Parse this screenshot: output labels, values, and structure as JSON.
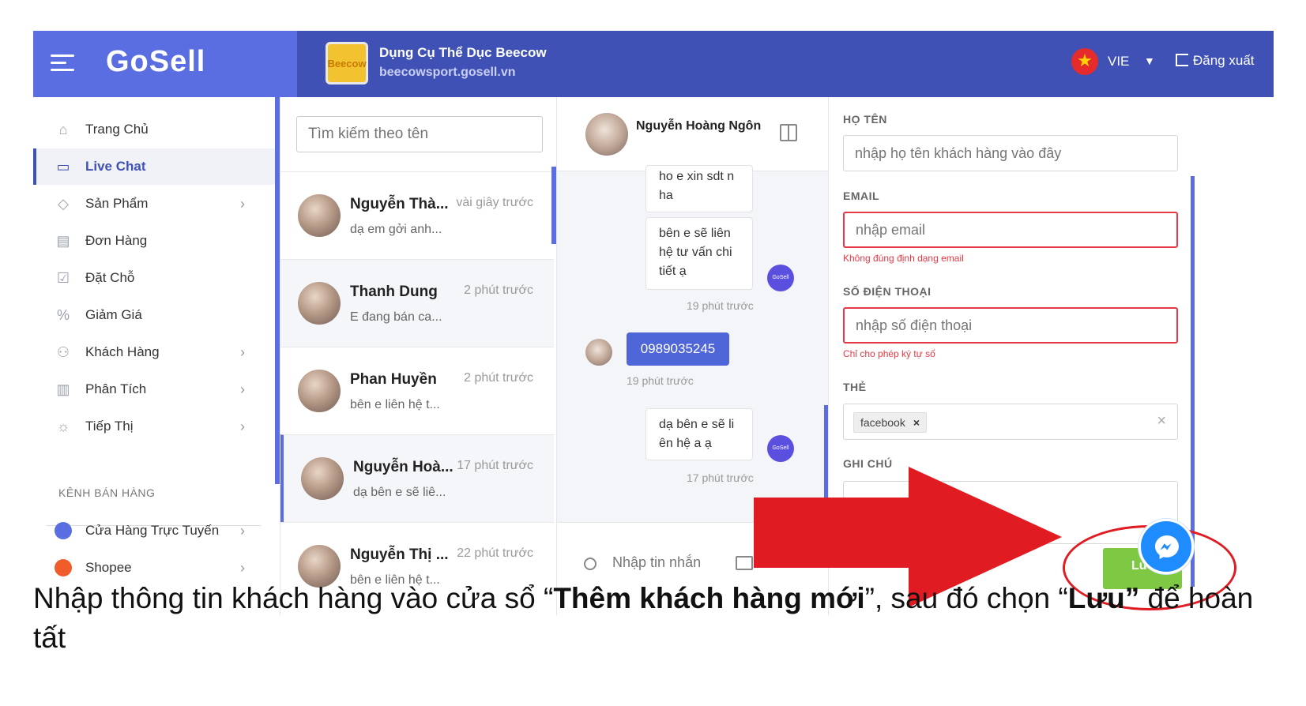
{
  "header": {
    "logo_text": "GoSell",
    "shop_logo_text": "Beecow",
    "shop_name": "Dụng Cụ Thể Dục Beecow",
    "shop_url": "beecowsport.gosell.vn",
    "language": "VIE",
    "logout_label": "Đăng xuất"
  },
  "sidebar": {
    "items": [
      {
        "label": "Trang Chủ",
        "icon": "home-icon"
      },
      {
        "label": "Live Chat",
        "icon": "chat-icon"
      },
      {
        "label": "Sản Phẩm",
        "icon": "tag-icon"
      },
      {
        "label": "Đơn Hàng",
        "icon": "document-icon"
      },
      {
        "label": "Đặt Chỗ",
        "icon": "calendar-check-icon"
      },
      {
        "label": "Giảm Giá",
        "icon": "discount-icon"
      },
      {
        "label": "Khách Hàng",
        "icon": "users-icon"
      },
      {
        "label": "Phân Tích",
        "icon": "bar-chart-icon"
      },
      {
        "label": "Tiếp Thị",
        "icon": "lightbulb-icon"
      }
    ],
    "section_title": "KÊNH BÁN HÀNG",
    "channels": [
      {
        "label": "Cửa Hàng Trực Tuyến",
        "icon": "store-icon"
      },
      {
        "label": "Shopee",
        "icon": "shopee-icon"
      }
    ]
  },
  "conversations": {
    "search_placeholder": "Tìm kiếm theo tên",
    "items": [
      {
        "name": "Nguyễn Thà...",
        "time": "vài giây trước",
        "preview": "dạ em gởi anh..."
      },
      {
        "name": "Thanh Dung",
        "time": "2 phút trước",
        "preview": "E đang bán ca..."
      },
      {
        "name": "Phan Huyền",
        "time": "2 phút trước",
        "preview": "bên e liên hệ t..."
      },
      {
        "name": "Nguyễn Hoà...",
        "time": "17 phút trước",
        "preview": "dạ bên e sẽ liê..."
      },
      {
        "name": "Nguyễn Thị ...",
        "time": "22 phút trước",
        "preview": "bên e liên hệ t..."
      }
    ]
  },
  "chat": {
    "contact_name": "Nguyễn Hoàng Ngôn",
    "messages": {
      "m1": "ho e xin sdt n ha",
      "m2": "bên e sẽ liên hệ tư vấn chi tiết ạ",
      "m2_time": "19 phút trước",
      "m3": "0989035245",
      "m3_time": "19 phút trước",
      "m4": "dạ bên e sẽ li ên hệ a ạ",
      "m4_time": "17 phút trước"
    },
    "input_placeholder": "Nhập tin nhắn",
    "mini_logo": "GoSell"
  },
  "form": {
    "name_label": "HỌ TÊN",
    "name_placeholder": "nhập họ tên khách hàng vào đây",
    "email_label": "EMAIL",
    "email_placeholder": "nhập email",
    "email_error": "Không đúng định dạng email",
    "phone_label": "SỐ ĐIỆN THOẠI",
    "phone_placeholder": "nhập số điện thoại",
    "phone_error": "Chỉ cho phép ký tự số",
    "tag_label": "THẺ",
    "tag_value": "facebook",
    "note_label": "GHI CHÚ",
    "save_label": "Lư"
  },
  "caption": {
    "part1": "Nhập thông tin khách hàng vào cửa sổ “",
    "bold1": "Thêm khách hàng mới",
    "part2": "”, sau đó chọn “",
    "bold2": "Lưu”",
    "part3": " để hoàn tất"
  },
  "colors": {
    "header_primary": "#3f51b5",
    "header_logo_bg": "#5b6ee1",
    "error": "#e53946",
    "save_button": "#7ec843",
    "annotation_red": "#e11b22"
  }
}
